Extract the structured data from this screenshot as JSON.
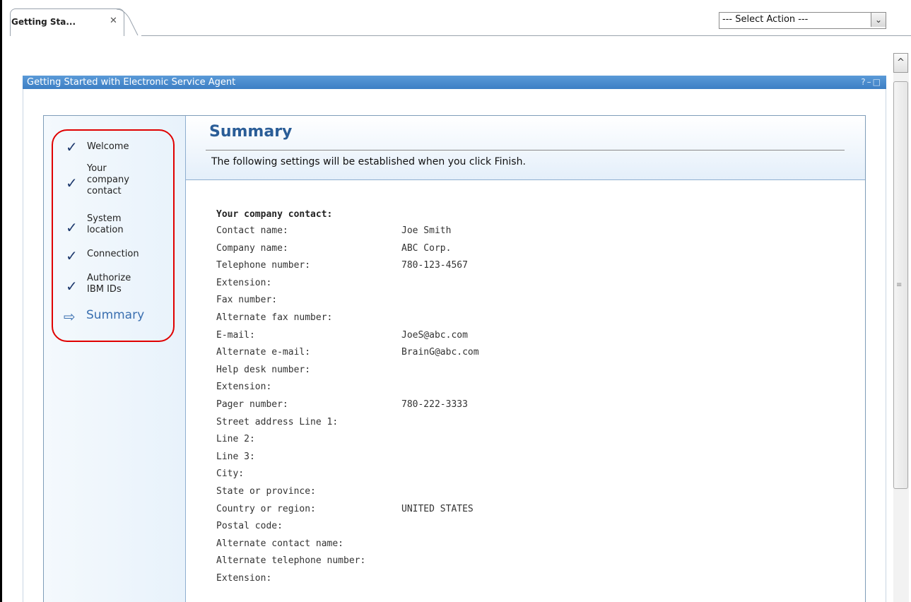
{
  "tabbar": {
    "tab_label": "Getting Sta...",
    "close_glyph": "✕",
    "select_action": "--- Select Action ---",
    "select_arrow": "⌄"
  },
  "portlet": {
    "title": "Getting Started with Electronic Service Agent",
    "controls": "?–□"
  },
  "scrollbar": {
    "up_glyph": "^",
    "grip_glyph": "≡"
  },
  "nav": {
    "check_glyph": "✓",
    "items": [
      {
        "label": "Welcome",
        "status": "complete"
      },
      {
        "label": "Your company contact",
        "status": "complete"
      },
      {
        "label": "System location",
        "status": "complete"
      },
      {
        "label": "Connection",
        "status": "complete"
      },
      {
        "label": "Authorize IBM IDs",
        "status": "complete"
      },
      {
        "label": "Summary",
        "status": "current"
      }
    ],
    "arrow_glyph": "⇨"
  },
  "content": {
    "title": "Summary",
    "description": "The following settings will be established when you click Finish.",
    "section_heading": "Your company contact:",
    "rows": [
      {
        "label": "Contact name:",
        "value": "Joe Smith"
      },
      {
        "label": "Company name:",
        "value": "ABC Corp."
      },
      {
        "label": "Telephone number:",
        "value": "780-123-4567"
      },
      {
        "label": "Extension:",
        "value": ""
      },
      {
        "label": "Fax number:",
        "value": ""
      },
      {
        "label": "Alternate fax number:",
        "value": ""
      },
      {
        "label": "E-mail:",
        "value": "JoeS@abc.com"
      },
      {
        "label": "Alternate e-mail:",
        "value": "BrainG@abc.com"
      },
      {
        "label": "Help desk number:",
        "value": ""
      },
      {
        "label": "Extension:",
        "value": ""
      },
      {
        "label": "Pager number:",
        "value": "780-222-3333"
      },
      {
        "label": "Street address Line 1:",
        "value": ""
      },
      {
        "label": "Line 2:",
        "value": ""
      },
      {
        "label": "Line 3:",
        "value": ""
      },
      {
        "label": "City:",
        "value": ""
      },
      {
        "label": "State or province:",
        "value": ""
      },
      {
        "label": "Country or region:",
        "value": "UNITED STATES"
      },
      {
        "label": "Postal code:",
        "value": ""
      },
      {
        "label": "Alternate contact name:",
        "value": ""
      },
      {
        "label": "Alternate telephone number:",
        "value": ""
      },
      {
        "label": "Extension:",
        "value": ""
      }
    ]
  },
  "colors": {
    "titlebar": "#3d7fc4",
    "heading": "#2a5d97",
    "highlight": "#e00000",
    "check": "#1e3a6e"
  }
}
